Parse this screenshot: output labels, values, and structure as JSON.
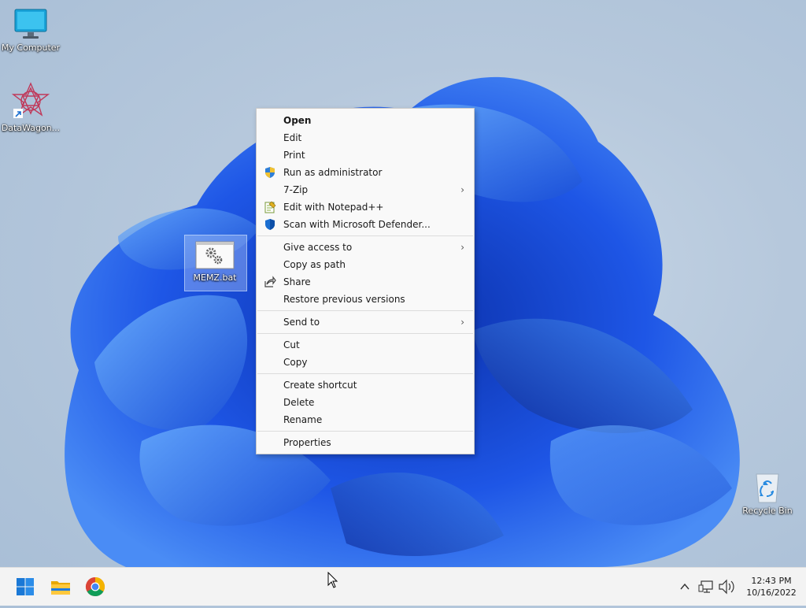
{
  "desktop": {
    "icons": {
      "my_computer": "My Computer",
      "datawagon": "DataWagon...",
      "memz": "MEMZ.bat",
      "recycle_bin": "Recycle Bin"
    }
  },
  "context_menu": {
    "open": "Open",
    "edit": "Edit",
    "print": "Print",
    "run_as_admin": "Run as administrator",
    "seven_zip": "7-Zip",
    "edit_notepadpp": "Edit with Notepad++",
    "scan_defender": "Scan with Microsoft Defender...",
    "give_access": "Give access to",
    "copy_as_path": "Copy as path",
    "share": "Share",
    "restore_versions": "Restore previous versions",
    "send_to": "Send to",
    "cut": "Cut",
    "copy": "Copy",
    "create_shortcut": "Create shortcut",
    "delete": "Delete",
    "rename": "Rename",
    "properties": "Properties",
    "submenu_arrow": "›"
  },
  "taskbar": {
    "pinned": [
      "start-icon",
      "file-explorer-icon",
      "chrome-icon"
    ],
    "tray_icons": [
      "chevron-up-icon",
      "network-icon",
      "volume-icon"
    ],
    "time": "12:43 PM",
    "date": "10/16/2022"
  },
  "colors": {
    "accent": "#0067c0",
    "wallpaper_blue": "#1f4fe0",
    "menu_bg": "#f9f9f9",
    "taskbar_bg": "#f3f3f3"
  }
}
